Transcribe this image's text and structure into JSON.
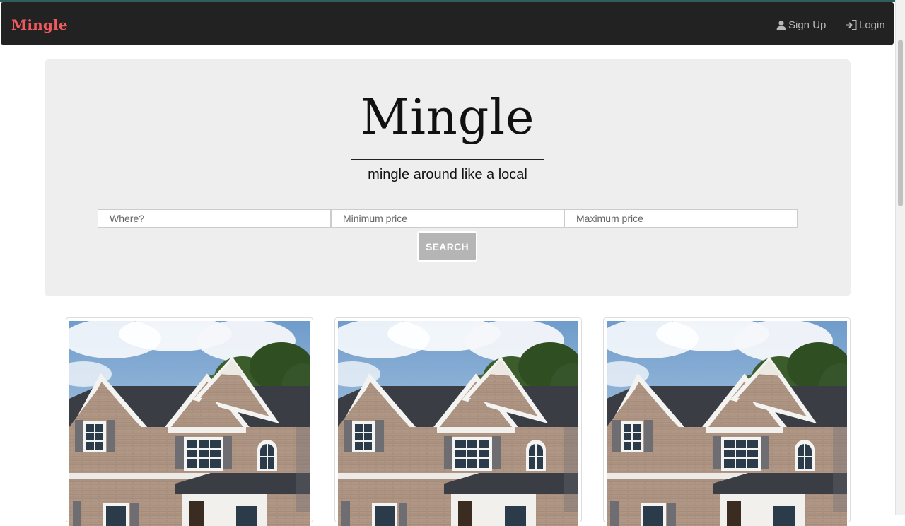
{
  "navbar": {
    "brand": "Mingle",
    "signup_label": "Sign Up",
    "login_label": "Login",
    "brand_color": "#f05a5f",
    "background": "#222222"
  },
  "hero": {
    "title": "Mingle",
    "tagline": "mingle around like a local"
  },
  "search": {
    "where_placeholder": "Where?",
    "min_price_placeholder": "Minimum price",
    "max_price_placeholder": "Maximum price",
    "button_label": "SEARCH"
  },
  "listings": [
    {
      "image": "house-photo"
    },
    {
      "image": "house-photo"
    },
    {
      "image": "house-photo"
    }
  ],
  "icons": {
    "signup": "user-icon",
    "login": "login-icon"
  }
}
